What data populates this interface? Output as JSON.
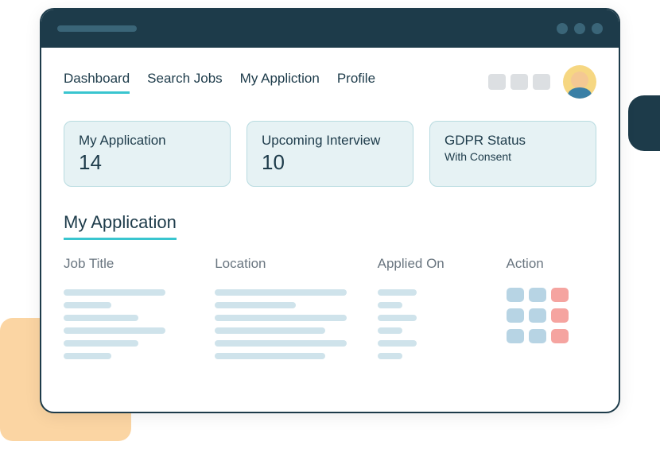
{
  "tabs": [
    "Dashboard",
    "Search Jobs",
    "My Appliction",
    "Profile"
  ],
  "active_tab_index": 0,
  "stats": [
    {
      "title": "My Application",
      "value": "14"
    },
    {
      "title": "Upcoming Interview",
      "value": "10"
    },
    {
      "title": "GDPR Status",
      "sub": "With Consent"
    }
  ],
  "section_title": "My Application",
  "table": {
    "columns": [
      "Job Title",
      "Location",
      "Applied On",
      "Action"
    ]
  }
}
